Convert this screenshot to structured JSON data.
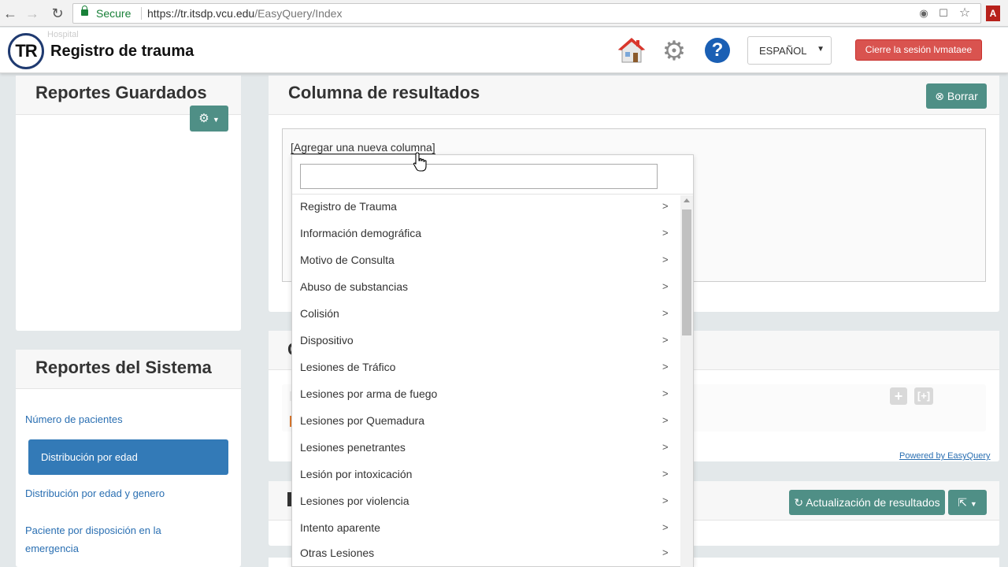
{
  "browser": {
    "secure_label": "Secure",
    "url_domain": "https://tr.itsdp.vcu.edu",
    "url_path": "/EasyQuery/Index",
    "pdf_ext_label": "A"
  },
  "header": {
    "logo_text": "TR",
    "logo_ghost": "Hospital",
    "title": "Registro de trauma",
    "language": "ESPAÑOL",
    "logout_label": "Cierre la sesión lvmataee"
  },
  "saved_reports": {
    "title": "Reportes Guardados"
  },
  "system_reports": {
    "title": "Reportes del Sistema",
    "items": [
      {
        "label": "Número de pacientes"
      },
      {
        "label": "Distribución por edad"
      },
      {
        "label": "Distribución por edad y genero"
      },
      {
        "label": "Paciente por disposición en la"
      },
      {
        "label": "emergencia"
      }
    ]
  },
  "results": {
    "title": "Columna de resultados",
    "clear_label": "Borrar",
    "add_column_label": "[Agregar una nueva columna]"
  },
  "conditions": {
    "title_fragment": "C",
    "powered_by": "Powered by EasyQuery"
  },
  "result_actions": {
    "refresh_label": "Actualización de resultados"
  },
  "dropdown": {
    "search_value": "",
    "items": [
      {
        "label": "Registro de Trauma",
        "arrow": ">"
      },
      {
        "label": "Información demográfica",
        "arrow": ">"
      },
      {
        "label": "Motivo de Consulta",
        "arrow": ">"
      },
      {
        "label": "Abuso de substancias",
        "arrow": ">"
      },
      {
        "label": "Colisión",
        "arrow": ">"
      },
      {
        "label": "Dispositivo",
        "arrow": ">"
      },
      {
        "label": "Lesiones de Tráfico",
        "arrow": ">"
      },
      {
        "label": "Lesiones por arma de fuego",
        "arrow": ">"
      },
      {
        "label": "Lesiones por Quemadura",
        "arrow": ">"
      },
      {
        "label": "Lesiones penetrantes",
        "arrow": ">"
      },
      {
        "label": "Lesión por intoxicación",
        "arrow": ">"
      },
      {
        "label": "Lesiones por violencia",
        "arrow": ">"
      },
      {
        "label": "Intento aparente",
        "arrow": ">"
      },
      {
        "label": "Otras Lesiones",
        "arrow": ">"
      }
    ]
  },
  "colors": {
    "teal_button": "#4f8f86",
    "primary_blue": "#337ab7",
    "danger_red": "#d9534f",
    "secure_green": "#188038"
  }
}
